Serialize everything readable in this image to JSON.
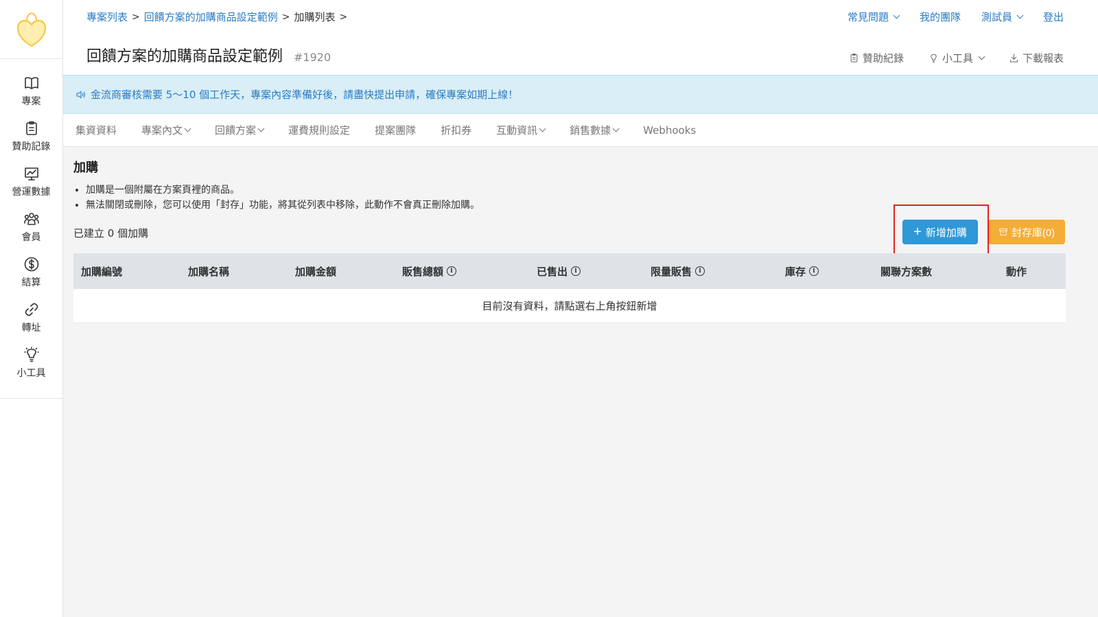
{
  "sidebar": {
    "items": [
      {
        "label": "專案",
        "icon": "book-icon"
      },
      {
        "label": "贊助記錄",
        "icon": "clipboard-icon"
      },
      {
        "label": "營運數據",
        "icon": "chart-icon"
      },
      {
        "label": "會員",
        "icon": "users-icon"
      },
      {
        "label": "結算",
        "icon": "dollar-icon"
      },
      {
        "label": "轉址",
        "icon": "link-icon"
      },
      {
        "label": "小工具",
        "icon": "lightbulb-icon"
      }
    ]
  },
  "header": {
    "breadcrumb": [
      "專案列表",
      "回饋方案的加購商品設定範例",
      "加購列表"
    ],
    "top_nav": [
      "常見問題",
      "我的團隊",
      "測試員",
      "登出"
    ],
    "title": "回饋方案的加購商品設定範例",
    "project_id": "#1920",
    "tools": [
      "贊助紀錄",
      "小工具",
      "下載報表"
    ]
  },
  "notice": "金流商審核需要 5～10 個工作天，專案內容準備好後，請盡快提出申請，確保專案如期上線！",
  "tabs": [
    {
      "label": "集資資料",
      "dropdown": false
    },
    {
      "label": "專案內文",
      "dropdown": true
    },
    {
      "label": "回饋方案",
      "dropdown": true
    },
    {
      "label": "運費規則設定",
      "dropdown": false
    },
    {
      "label": "提案團隊",
      "dropdown": false
    },
    {
      "label": "折扣券",
      "dropdown": false
    },
    {
      "label": "互動資訊",
      "dropdown": true
    },
    {
      "label": "銷售數據",
      "dropdown": true
    },
    {
      "label": "Webhooks",
      "dropdown": false
    }
  ],
  "section": {
    "title": "加購",
    "bullets": [
      "加購是一個附屬在方案頁裡的商品。",
      "無法關閉或刪除，您可以使用「封存」功能，將其從列表中移除，此動作不會真正刪除加購。"
    ],
    "count_text": "已建立 0 個加購",
    "add_button": "新增加購",
    "archive_button": "封存庫(0)"
  },
  "table": {
    "columns": [
      {
        "label": "加購編號",
        "info": false
      },
      {
        "label": "加購名稱",
        "info": false
      },
      {
        "label": "加購金額",
        "info": false
      },
      {
        "label": "販售總額",
        "info": true
      },
      {
        "label": "已售出",
        "info": true
      },
      {
        "label": "限量販售",
        "info": true
      },
      {
        "label": "庫存",
        "info": true
      },
      {
        "label": "關聯方案數",
        "info": false
      },
      {
        "label": "動作",
        "info": false
      }
    ],
    "empty_message": "目前沒有資料，請點選右上角按鈕新增"
  },
  "colors": {
    "link": "#2b7cc4",
    "primary_button": "#2f98d6",
    "archive_button": "#f5a623",
    "notice_bg": "#d9eef6",
    "logo": "#f7c948",
    "highlight": "#e02020"
  }
}
